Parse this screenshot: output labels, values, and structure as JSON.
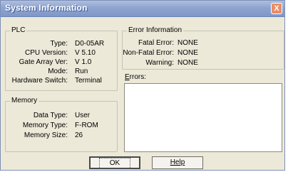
{
  "window": {
    "title": "System Information",
    "close_glyph": "X"
  },
  "plc": {
    "legend": "PLC",
    "fields": [
      {
        "label": "Type:",
        "value": "D0-05AR"
      },
      {
        "label": "CPU Version:",
        "value": "V 5.10"
      },
      {
        "label": "Gate Array Ver:",
        "value": "V 1.0"
      },
      {
        "label": "Mode:",
        "value": "Run"
      },
      {
        "label": "Hardware Switch:",
        "value": "Terminal"
      }
    ]
  },
  "memory": {
    "legend": "Memory",
    "fields": [
      {
        "label": "Data Type:",
        "value": "User"
      },
      {
        "label": "Memory Type:",
        "value": "F-ROM"
      },
      {
        "label": "Memory Size:",
        "value": "26"
      }
    ]
  },
  "error_info": {
    "legend": "Error Information",
    "fields": [
      {
        "label": "Fatal Error:",
        "value": "NONE"
      },
      {
        "label": "Non-Fatal Error:",
        "value": "NONE"
      },
      {
        "label": "Warning:",
        "value": "NONE"
      }
    ]
  },
  "errors": {
    "label_mnemonic": "E",
    "label_rest": "rrors:",
    "text": ""
  },
  "buttons": {
    "ok": "OK",
    "help": "Help"
  }
}
